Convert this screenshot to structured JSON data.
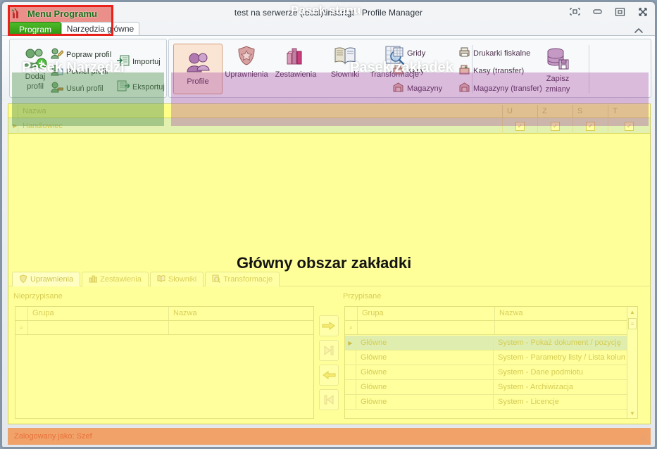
{
  "window": {
    "title": "test na serwerze (local)\\insertgt - Profile Manager",
    "controls": {
      "layout": "layout-icon",
      "minimize": "minimize-icon",
      "maximize": "maximize-icon",
      "close": "close-icon",
      "collapse_ribbon": "chevron-up-icon"
    }
  },
  "overlays": {
    "menu": "Menu Programu",
    "toolbar": "Pasek Narzędzi",
    "tabs": "Pasek zakładek",
    "main_area": "Główny obszar zakładki",
    "status": "Pasek stanu",
    "colors": {
      "menu_box": "#e8221a",
      "menu_label": "#1d6b15",
      "toolbar_tint": "#5a965a",
      "tabs_tint": "#a03ca0",
      "status_bg": "#f0a268"
    }
  },
  "ribbon_tabs": [
    {
      "label": "Program",
      "state": "menu"
    },
    {
      "label": "Narzędzia główne",
      "state": "active"
    }
  ],
  "toolbar_group": {
    "big_item": {
      "label_line1": "Dodaj",
      "label_line2": "profil",
      "icon": "add-profile-icon"
    },
    "items": [
      {
        "label": "Popraw profil",
        "icon": "edit-profile-icon"
      },
      {
        "label": "Powiel profil",
        "icon": "duplicate-profile-icon"
      },
      {
        "label": "Usuń profil",
        "icon": "delete-profile-icon"
      },
      {
        "label": "Importuj",
        "icon": "import-icon"
      },
      {
        "label": "Eksportuj",
        "icon": "export-icon"
      }
    ]
  },
  "tabs_group": {
    "big_items": [
      {
        "label": "Profile",
        "icon": "profiles-icon",
        "selected": true
      },
      {
        "label": "Uprawnienia",
        "icon": "shield-icon",
        "selected": false
      },
      {
        "label": "Zestawienia",
        "icon": "bar-chart-icon",
        "selected": false
      },
      {
        "label": "Słowniki",
        "icon": "book-icon",
        "selected": false
      },
      {
        "label": "Transformacje",
        "icon": "magnifier-grid-icon",
        "selected": false
      }
    ],
    "small_items_col1": [
      {
        "label": "Gridy",
        "icon": "grid-icon"
      },
      {
        "label": "Kasy",
        "icon": "cash-register-icon"
      },
      {
        "label": "Magazyny",
        "icon": "warehouse-icon"
      }
    ],
    "small_items_col2": [
      {
        "label": "Drukarki fiskalne",
        "icon": "fiscal-printer-icon"
      },
      {
        "label": "Kasy (transfer)",
        "icon": "cash-register-transfer-icon"
      },
      {
        "label": "Magazyny (transfer)",
        "icon": "warehouse-transfer-icon"
      }
    ],
    "save_item": {
      "label_line1": "Zapisz",
      "label_line2": "zmiany",
      "icon": "database-save-icon"
    }
  },
  "profiles_grid": {
    "columns": [
      "Nazwa",
      "U",
      "Z",
      "S",
      "T"
    ],
    "rows": [
      {
        "nazwa": "Handlowiec",
        "u": "✓",
        "z": "✓",
        "s": "✓",
        "t": "✓"
      }
    ]
  },
  "bottom_tabs": [
    {
      "label": "Uprawnienia",
      "icon": "shield-icon",
      "active": true
    },
    {
      "label": "Zestawienia",
      "icon": "bar-chart-icon",
      "active": false
    },
    {
      "label": "Słowniki",
      "icon": "book-icon",
      "active": false
    },
    {
      "label": "Transformacje",
      "icon": "magnifier-grid-icon",
      "active": false
    }
  ],
  "left_panel": {
    "label": "Nieprzypisane",
    "columns": [
      "Grupa",
      "Nazwa"
    ],
    "rows": []
  },
  "right_panel": {
    "label": "Przypisane",
    "columns": [
      "Grupa",
      "Nazwa"
    ],
    "rows": [
      {
        "grupa": "Główne",
        "nazwa": "System - Pokaż dokument / pozycję",
        "selected": true
      },
      {
        "grupa": "Główne",
        "nazwa": "System - Parametry listy / Lista kolumn",
        "selected": false
      },
      {
        "grupa": "Główne",
        "nazwa": "System - Dane podmiotu",
        "selected": false
      },
      {
        "grupa": "Główne",
        "nazwa": "System - Archiwizacja",
        "selected": false
      },
      {
        "grupa": "Główne",
        "nazwa": "System - Licencje",
        "selected": false
      }
    ]
  },
  "transfer_buttons": [
    {
      "name": "move-right-button",
      "icon": "arrow-right-icon"
    },
    {
      "name": "move-all-right-button",
      "icon": "arrow-right-all-icon"
    },
    {
      "name": "move-left-button",
      "icon": "arrow-left-icon"
    },
    {
      "name": "move-all-left-button",
      "icon": "arrow-left-all-icon"
    }
  ],
  "statusbar": {
    "text": "Zalogowany jako: Szef"
  }
}
